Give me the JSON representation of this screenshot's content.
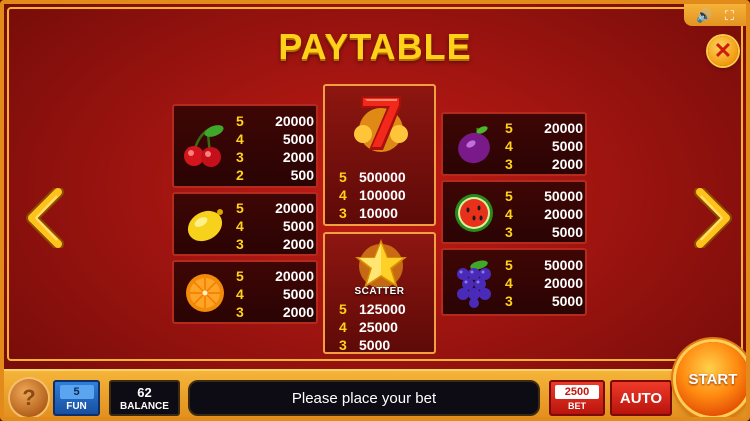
{
  "title": "PAYTABLE",
  "top_controls": {
    "sound_icon": "🔊",
    "fullscreen_icon": "⛶"
  },
  "close_label": "✕",
  "symbols": {
    "cherry": {
      "name": "cherry",
      "pays": [
        [
          "5",
          "20000"
        ],
        [
          "4",
          "5000"
        ],
        [
          "3",
          "2000"
        ],
        [
          "2",
          "500"
        ]
      ]
    },
    "lemon": {
      "name": "lemon",
      "pays": [
        [
          "5",
          "20000"
        ],
        [
          "4",
          "5000"
        ],
        [
          "3",
          "2000"
        ]
      ]
    },
    "orange": {
      "name": "orange",
      "pays": [
        [
          "5",
          "20000"
        ],
        [
          "4",
          "5000"
        ],
        [
          "3",
          "2000"
        ]
      ]
    },
    "seven": {
      "name": "seven",
      "pays": [
        [
          "5",
          "500000"
        ],
        [
          "4",
          "100000"
        ],
        [
          "3",
          "10000"
        ]
      ]
    },
    "scatter": {
      "name": "star",
      "label": "SCATTER",
      "pays": [
        [
          "5",
          "125000"
        ],
        [
          "4",
          "25000"
        ],
        [
          "3",
          "5000"
        ]
      ]
    },
    "plum": {
      "name": "plum",
      "pays": [
        [
          "5",
          "20000"
        ],
        [
          "4",
          "5000"
        ],
        [
          "3",
          "2000"
        ]
      ]
    },
    "watermelon": {
      "name": "watermelon",
      "pays": [
        [
          "5",
          "50000"
        ],
        [
          "4",
          "20000"
        ],
        [
          "3",
          "5000"
        ]
      ]
    },
    "grapes": {
      "name": "grapes",
      "pays": [
        [
          "5",
          "50000"
        ],
        [
          "4",
          "20000"
        ],
        [
          "3",
          "5000"
        ]
      ]
    }
  },
  "bottom": {
    "help_label": "?",
    "fun_value": "5",
    "fun_label": "FUN",
    "balance_value": "62",
    "balance_label": "BALANCE",
    "message": "Please place your bet",
    "bet_value": "2500",
    "bet_label": "BET",
    "auto_label": "AUTO",
    "start_label": "START"
  },
  "colors": {
    "accent_gold": "#ffd21a",
    "frame_orange": "#e28a1a",
    "bg_red": "#9e1410"
  }
}
